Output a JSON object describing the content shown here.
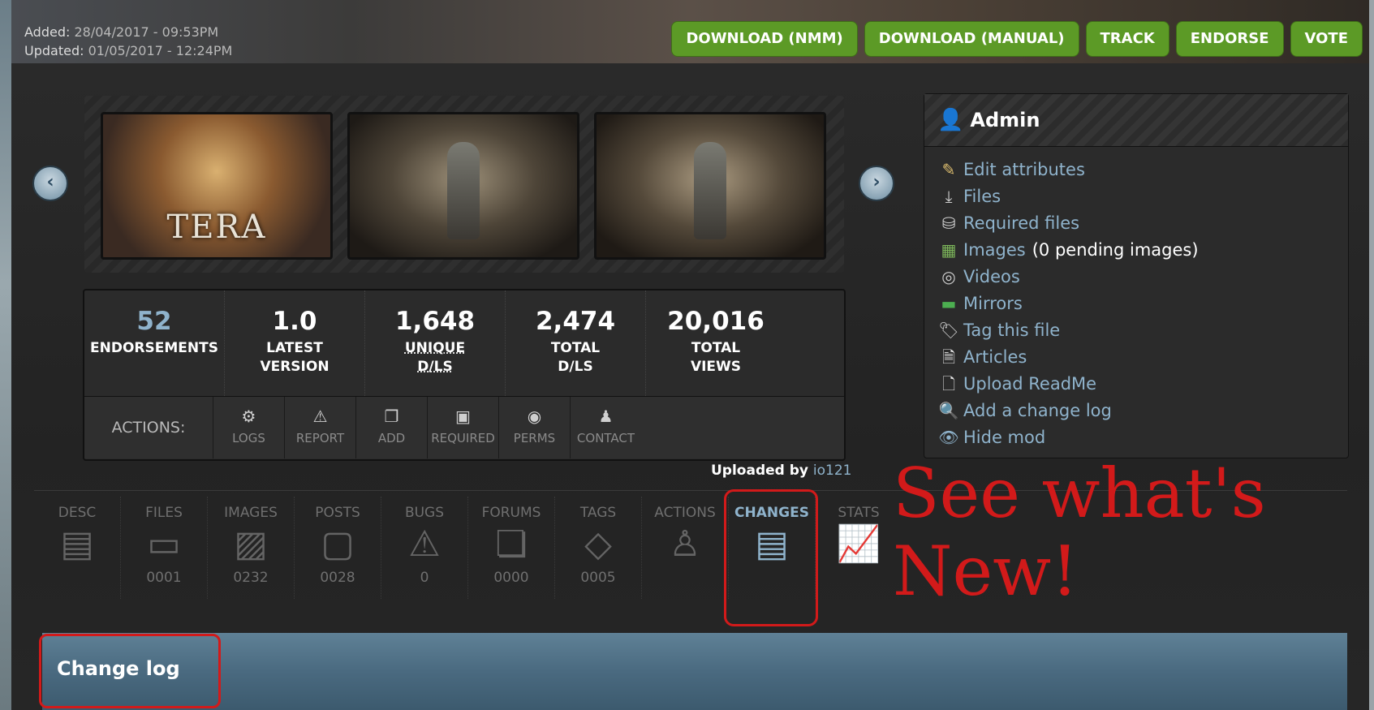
{
  "header": {
    "added_label": "Added:",
    "added_value": "28/04/2017 - 09:53PM",
    "updated_label": "Updated:",
    "updated_value": "01/05/2017 - 12:24PM",
    "buttons": [
      "DOWNLOAD (NMM)",
      "DOWNLOAD (MANUAL)",
      "TRACK",
      "ENDORSE",
      "VOTE"
    ]
  },
  "carousel": {
    "thumb1_text": "TERA",
    "prev_icon": "chevron-left-icon",
    "next_icon": "chevron-right-icon"
  },
  "stats": [
    {
      "value": "52",
      "label": "ENDORSEMENTS"
    },
    {
      "value": "1.0",
      "label": "LATEST VERSION"
    },
    {
      "value": "1,648",
      "label": "UNIQUE D/LS"
    },
    {
      "value": "2,474",
      "label": "TOTAL D/LS"
    },
    {
      "value": "20,016",
      "label": "TOTAL VIEWS"
    }
  ],
  "actions": {
    "label": "ACTIONS:",
    "items": [
      {
        "label": "LOGS",
        "icon": "gear-icon"
      },
      {
        "label": "REPORT",
        "icon": "warning-icon"
      },
      {
        "label": "ADD",
        "icon": "stack-icon"
      },
      {
        "label": "REQUIRED",
        "icon": "disk-icon"
      },
      {
        "label": "PERMS",
        "icon": "permissions-icon"
      },
      {
        "label": "CONTACT",
        "icon": "user-icon"
      }
    ]
  },
  "admin": {
    "title": "Admin",
    "items": [
      {
        "label": "Edit attributes",
        "icon": "pencil-icon"
      },
      {
        "label": "Files",
        "icon": "download-icon"
      },
      {
        "label": "Required files",
        "icon": "required-icon"
      },
      {
        "label": "Images",
        "extra": "(0 pending images)",
        "icon": "image-icon"
      },
      {
        "label": "Videos",
        "icon": "webcam-icon"
      },
      {
        "label": "Mirrors",
        "icon": "mirror-icon"
      },
      {
        "label": "Tag this file",
        "icon": "tag-icon"
      },
      {
        "label": "Articles",
        "icon": "document-icon"
      },
      {
        "label": "Upload ReadMe",
        "icon": "readme-icon"
      },
      {
        "label": "Add a change log",
        "icon": "magnifier-icon"
      },
      {
        "label": "Hide mod",
        "icon": "eye-icon"
      }
    ]
  },
  "uploaded": {
    "label": "Uploaded by",
    "user": "io121"
  },
  "tabs": [
    {
      "label": "DESC",
      "count": "",
      "icon": "clipboard-icon"
    },
    {
      "label": "FILES",
      "count": "0001",
      "icon": "folder-icon"
    },
    {
      "label": "IMAGES",
      "count": "0232",
      "icon": "image-icon"
    },
    {
      "label": "POSTS",
      "count": "0028",
      "icon": "speech-bubble-icon"
    },
    {
      "label": "BUGS",
      "count": "0",
      "icon": "warning-icon"
    },
    {
      "label": "FORUMS",
      "count": "0000",
      "icon": "chat-bubbles-icon"
    },
    {
      "label": "TAGS",
      "count": "0005",
      "icon": "tag-icon"
    },
    {
      "label": "ACTIONS",
      "count": "",
      "icon": "user-icon"
    },
    {
      "label": "CHANGES",
      "count": "",
      "icon": "clipboard-icon"
    },
    {
      "label": "STATS",
      "count": "",
      "icon": "line-chart-icon"
    }
  ],
  "annotation": {
    "line1": "See what's",
    "line2": "New!"
  },
  "changelog": {
    "title": "Change log"
  },
  "colors": {
    "accent": "#8fb3cc",
    "button": "#5c9a26",
    "highlight": "#d21a1a"
  }
}
